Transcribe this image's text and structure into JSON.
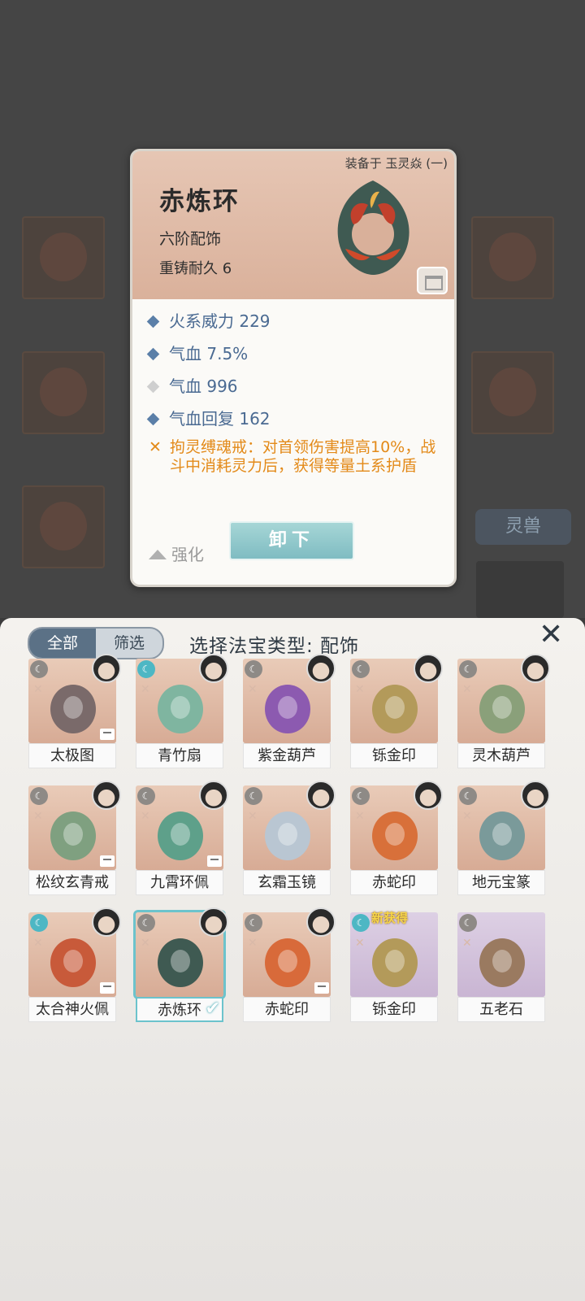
{
  "background": {
    "side_tab": "灵兽"
  },
  "popup": {
    "equipped_on": "装备于 玉灵焱 (一)",
    "name": "赤炼环",
    "grade": "六阶配饰",
    "durability": "重铸耐久 6",
    "stats": [
      {
        "text": "火系威力 229",
        "marker": "blue"
      },
      {
        "text": "气血 7.5%",
        "marker": "blue"
      },
      {
        "text": "气血 996",
        "marker": "grey"
      },
      {
        "text": "气血回复 162",
        "marker": "blue"
      }
    ],
    "effect": "拘灵缚魂戒：对首领伤害提高10%，战斗中消耗灵力后，获得等量土系护盾",
    "upgrade_label": "强化",
    "unequip_label": "卸下",
    "colors": {
      "stat": "#4a6a92",
      "effect": "#e38a19",
      "button": "#7fbcc2"
    }
  },
  "sheet": {
    "tab_all": "全部",
    "tab_filter": "筛选",
    "title": "选择法宝类型: 配饰",
    "close_icon": "close-icon",
    "items": [
      {
        "name": "太极图",
        "locked": true,
        "badge": "default"
      },
      {
        "name": "青竹扇",
        "locked": false,
        "badge": "cyan"
      },
      {
        "name": "紫金葫芦",
        "locked": false,
        "badge": "default"
      },
      {
        "name": "铄金印",
        "locked": false,
        "badge": "default"
      },
      {
        "name": "灵木葫芦",
        "locked": false,
        "badge": "default"
      },
      {
        "name": "松纹玄青戒",
        "locked": true,
        "badge": "default"
      },
      {
        "name": "九霄环佩",
        "locked": true,
        "badge": "default"
      },
      {
        "name": "玄霜玉镜",
        "locked": false,
        "badge": "default"
      },
      {
        "name": "赤蛇印",
        "locked": false,
        "badge": "default"
      },
      {
        "name": "地元宝篆",
        "locked": false,
        "badge": "default"
      },
      {
        "name": "太合神火佩",
        "locked": true,
        "badge": "cyan"
      },
      {
        "name": "赤炼环",
        "locked": false,
        "badge": "default",
        "selected": true
      },
      {
        "name": "赤蛇印",
        "locked": true,
        "badge": "default"
      },
      {
        "name": "铄金印",
        "locked": false,
        "badge": "cyan",
        "tag": "新获得",
        "purple": true
      },
      {
        "name": "五老石",
        "locked": false,
        "badge": "default",
        "purple": true
      }
    ]
  }
}
